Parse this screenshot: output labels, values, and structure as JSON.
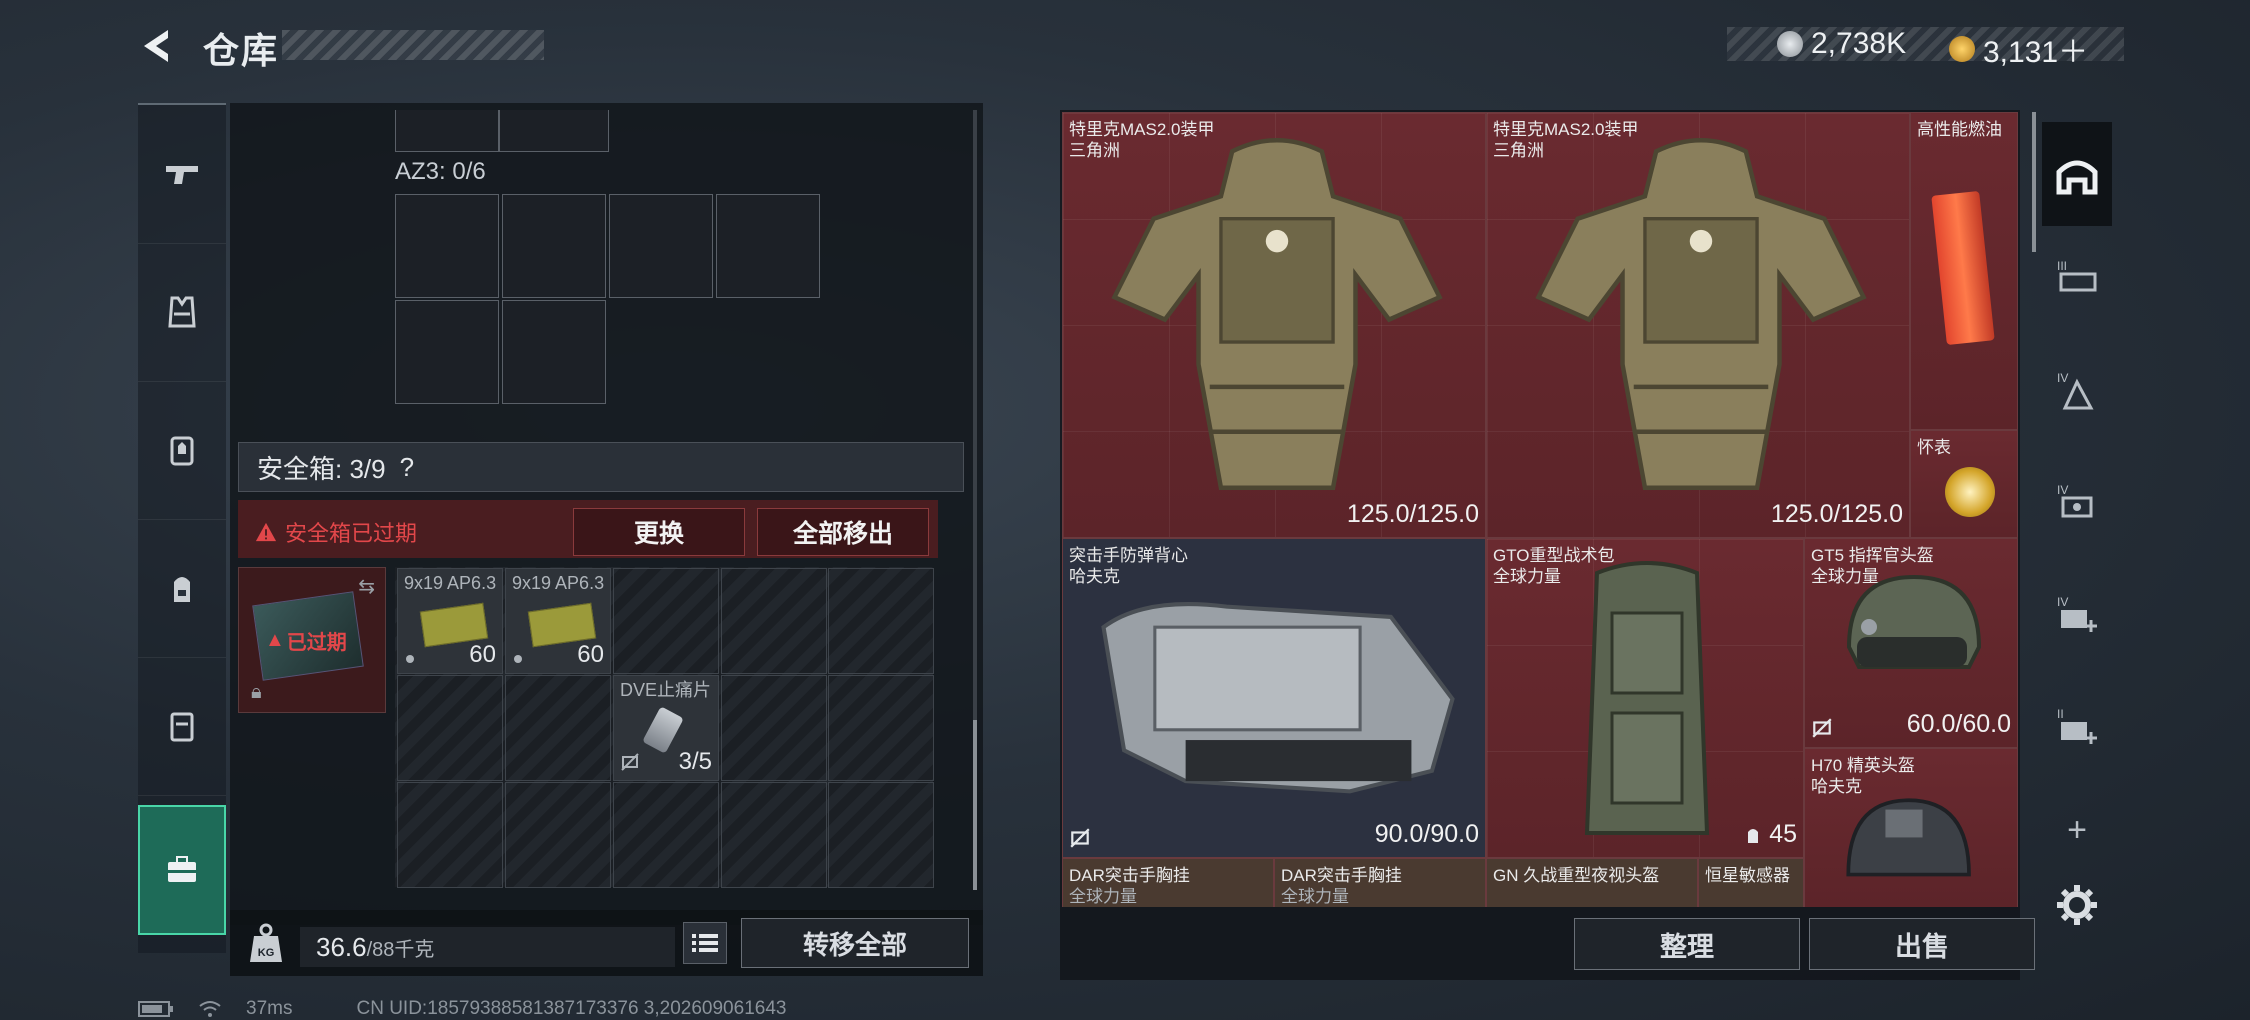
{
  "header": {
    "title": "仓库",
    "currency": [
      {
        "icon": "silver-coin-icon",
        "amount": "2,738K",
        "color": "#c9ced3"
      },
      {
        "icon": "gold-coin-icon",
        "amount": "3,131＋",
        "color": "#e0a83a"
      }
    ]
  },
  "left_rail": {
    "items": [
      {
        "icon": "pistol-icon"
      },
      {
        "icon": "armor-vest-icon"
      },
      {
        "icon": "chest-rig-icon"
      },
      {
        "icon": "backpack-icon"
      },
      {
        "icon": "case-icon"
      },
      {
        "icon": "safebox-icon",
        "active": true
      }
    ]
  },
  "container": {
    "az3_label": "AZ3: 0/6"
  },
  "safebox": {
    "label": "安全箱: 3/9",
    "help": "?",
    "expired_text": "安全箱已过期",
    "replace_label": "更换",
    "move_all_label": "全部移出",
    "thumb_expired": "已过期",
    "items": [
      {
        "name": "9x19 AP6.3",
        "count": "60"
      },
      {
        "name": "9x19 AP6.3",
        "count": "60"
      },
      {
        "name": "DVE止痛片",
        "count": "3/5"
      }
    ]
  },
  "weight": {
    "value": "36.6",
    "unit": "/88千克"
  },
  "transfer_all_label": "转移全部",
  "stash": {
    "tiles": [
      {
        "name": "特里克MAS2.0装甲",
        "sub": "三角洲",
        "value": "125.0/125.0"
      },
      {
        "name": "特里克MAS2.0装甲",
        "sub": "三角洲",
        "value": "125.0/125.0"
      },
      {
        "name": "高性能燃油",
        "sub": "",
        "value": ""
      },
      {
        "name": "怀表",
        "sub": "",
        "value": ""
      },
      {
        "name": "突击手防弹背心",
        "sub": "哈夫克",
        "value": "90.0/90.0"
      },
      {
        "name": "GTO重型战术包",
        "sub": "全球力量",
        "value": "45"
      },
      {
        "name": "GT5 指挥官头盔",
        "sub": "全球力量",
        "value": "60.0/60.0"
      },
      {
        "name": "H70 精英头盔",
        "sub": "哈夫克",
        "value": ""
      },
      {
        "name": "DAR突击手胸挂",
        "sub": "全球力量",
        "value": ""
      },
      {
        "name": "DAR突击手胸挂",
        "sub": "全球力量",
        "value": ""
      },
      {
        "name": "GN 久战重型夜视头盔",
        "sub": "",
        "value": ""
      },
      {
        "name": "恒星敏感器",
        "sub": "",
        "value": ""
      }
    ]
  },
  "actions": {
    "tidy_label": "整理",
    "sell_label": "出售"
  },
  "right_rail": {
    "items": [
      {
        "icon": "stash-home-icon",
        "active": true
      },
      {
        "icon": "stash-tier3-icon"
      },
      {
        "icon": "stash-tier4-icon"
      },
      {
        "icon": "stash-tier4b-icon"
      },
      {
        "icon": "stash-add-tier4-icon"
      },
      {
        "icon": "stash-add-tier2-icon"
      },
      {
        "icon": "plus-icon"
      },
      {
        "icon": "gear-icon"
      }
    ],
    "plus_label": "+"
  },
  "status": {
    "ping": "37ms",
    "uid": "CN UID:18579388581387173376 3,202609061643"
  }
}
